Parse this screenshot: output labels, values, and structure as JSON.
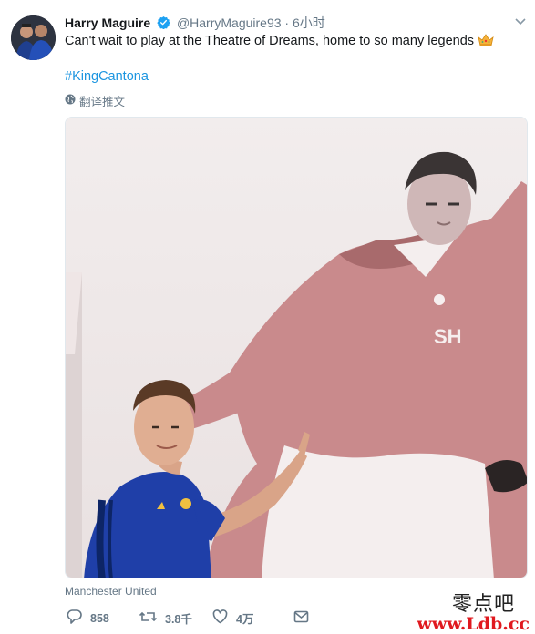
{
  "tweet": {
    "author": {
      "display_name": "Harry Maguire",
      "handle": "@HarryMaguire93",
      "separator": "·",
      "time": "6小时"
    },
    "text": "Can't wait to play at the Theatre of Dreams, home to so many legends",
    "hashtag": "#KingCantona",
    "translate_label": "翻译推文",
    "location": "Manchester United",
    "actions": {
      "reply_count": "858",
      "retweet_count": "3.8千",
      "like_count": "4万"
    }
  },
  "watermark": {
    "title": "零点吧",
    "url": "www.Ldb.cc"
  },
  "colors": {
    "link": "#1b95e0",
    "muted": "#657786",
    "verified": "#1da1f2",
    "watermark_red": "#e0191f"
  },
  "icons": [
    "verified-badge-icon",
    "crown-emoji-icon",
    "globe-icon",
    "chevron-down-icon",
    "reply-icon",
    "retweet-icon",
    "like-icon",
    "share-icon"
  ]
}
